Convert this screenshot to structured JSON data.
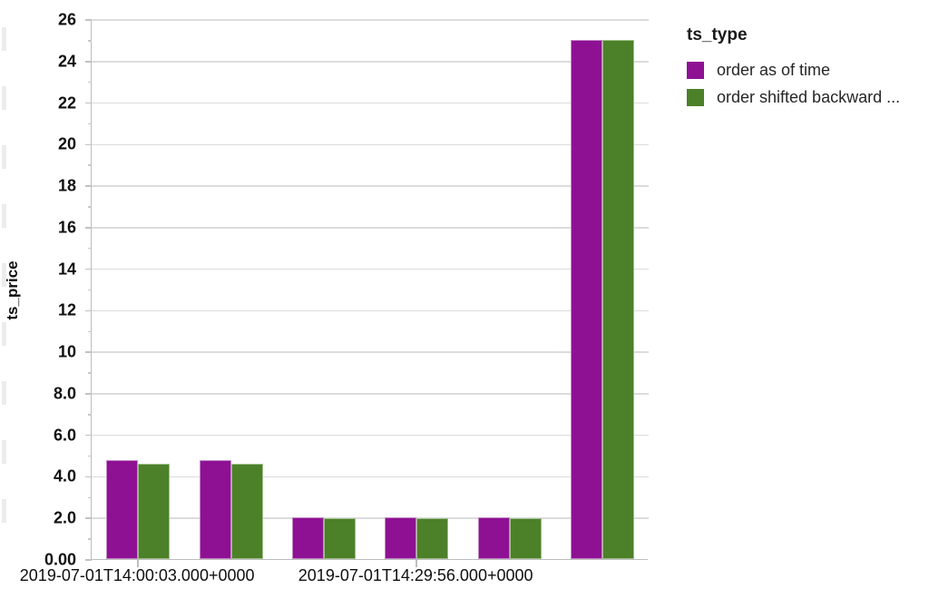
{
  "chart_data": {
    "type": "bar",
    "title": "",
    "subtitle": "",
    "xlabel": "",
    "ylabel": "ts_price",
    "ylim": [
      0,
      26
    ],
    "yticks": [
      "0.00",
      "2.0",
      "4.0",
      "6.0",
      "8.0",
      "10",
      "12",
      "14",
      "16",
      "18",
      "20",
      "22",
      "24",
      "26"
    ],
    "ytick_values": [
      0,
      2,
      4,
      6,
      8,
      10,
      12,
      14,
      16,
      18,
      20,
      22,
      24,
      26
    ],
    "grid": true,
    "legend_position": "right",
    "legend_title": "ts_type",
    "x_tick_labels": [
      "2019-07-01T14:00:03.000+0000",
      "2019-07-01T14:29:56.000+0000"
    ],
    "x_tick_positions": [
      0,
      3
    ],
    "categories": [
      "g1",
      "g2",
      "g3",
      "g4",
      "g5",
      "g6"
    ],
    "series": [
      {
        "name": "order as of time",
        "color": "#8E1194",
        "values": [
          4.75,
          4.75,
          2.0,
          2.0,
          2.0,
          25.0
        ]
      },
      {
        "name": "order shifted backward ...",
        "color": "#4C8029",
        "values": [
          4.6,
          4.6,
          1.95,
          1.95,
          1.95,
          25.0
        ]
      }
    ]
  },
  "axes": {
    "y_title": "ts_price",
    "y_tick_labels": [
      "26",
      "24",
      "22",
      "20",
      "18",
      "16",
      "14",
      "12",
      "10",
      "8.0",
      "6.0",
      "4.0",
      "2.0",
      "0.00"
    ],
    "x_tick_labels": [
      "2019-07-01T14:00:03.000+0000",
      "2019-07-01T14:29:56.000+0000"
    ]
  },
  "legend": {
    "title": "ts_type",
    "items": [
      {
        "label": "order as of time",
        "color": "#8E1194",
        "swatch": "purple-swatch"
      },
      {
        "label": "order shifted backward ...",
        "color": "#4C8029",
        "swatch": "green-swatch"
      }
    ]
  },
  "colors": {
    "purple": "#8E1194",
    "green": "#4C8029",
    "grid": "#dcdcdc",
    "axis": "#bdbdbd",
    "text": "#101010",
    "background": "#ffffff"
  }
}
